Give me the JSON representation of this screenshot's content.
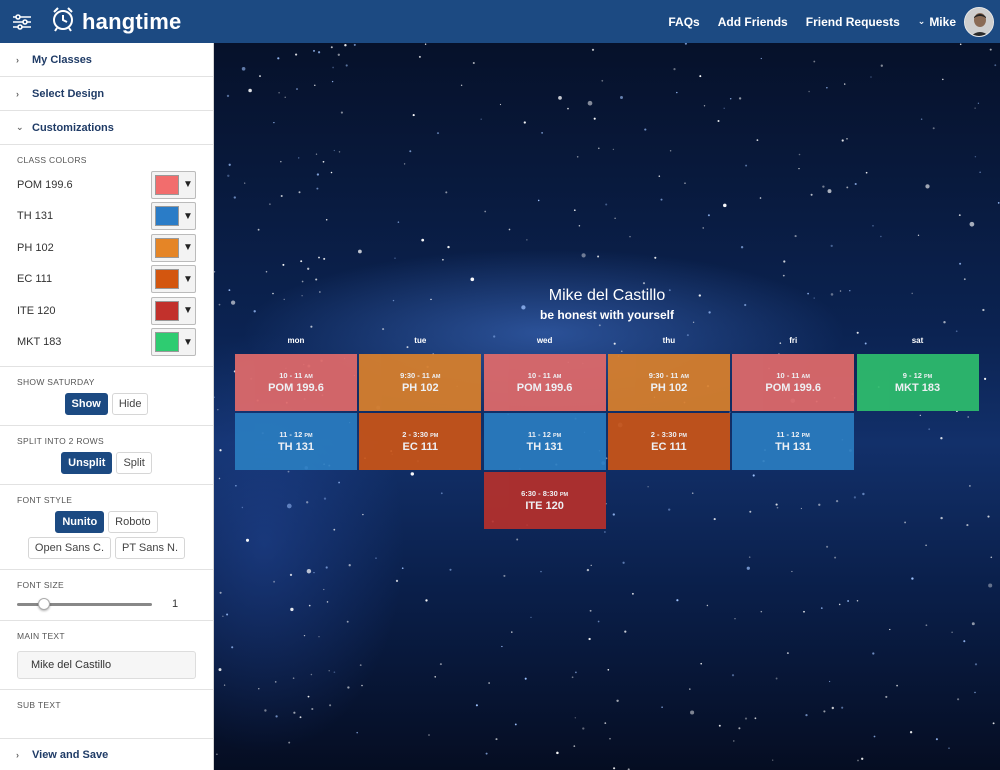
{
  "header": {
    "app_name": "hangtime",
    "nav": [
      "FAQs",
      "Add Friends",
      "Friend Requests"
    ],
    "user_name": "Mike"
  },
  "sidebar": {
    "sections": {
      "my_classes": "My Classes",
      "select_design": "Select Design",
      "customizations": "Customizations",
      "view_save": "View and Save"
    },
    "class_colors": {
      "title": "CLASS COLORS",
      "items": [
        {
          "name": "POM 199.6",
          "color": "#f26d6d"
        },
        {
          "name": "TH 131",
          "color": "#2a7cc7"
        },
        {
          "name": "PH 102",
          "color": "#e58526"
        },
        {
          "name": "EC 111",
          "color": "#d3560f"
        },
        {
          "name": "ITE 120",
          "color": "#c2312c"
        },
        {
          "name": "MKT 183",
          "color": "#2ecc71"
        }
      ]
    },
    "show_saturday": {
      "title": "SHOW SATURDAY",
      "options": [
        "Show",
        "Hide"
      ],
      "selected": "Show"
    },
    "split_rows": {
      "title": "SPLIT INTO 2 ROWS",
      "options": [
        "Unsplit",
        "Split"
      ],
      "selected": "Unsplit"
    },
    "font_style": {
      "title": "FONT STYLE",
      "options": [
        "Nunito",
        "Roboto",
        "Open Sans C.",
        "PT Sans N."
      ],
      "selected": "Nunito"
    },
    "font_size": {
      "title": "FONT SIZE",
      "value": "1",
      "fraction": 0.2
    },
    "main_text": {
      "title": "MAIN TEXT",
      "value": "Mike del Castillo"
    },
    "sub_text": {
      "title": "SUB TEXT"
    }
  },
  "schedule": {
    "title": "Mike del Castillo",
    "subtitle": "be honest with yourself",
    "days": [
      "mon",
      "tue",
      "wed",
      "thu",
      "fri",
      "sat"
    ],
    "classes": [
      {
        "day": 0,
        "row": 0,
        "time": "10 - 11",
        "ampm": "AM",
        "name": "POM 199.6",
        "color": "#e06a6a"
      },
      {
        "day": 0,
        "row": 1,
        "time": "11 - 12",
        "ampm": "PM",
        "name": "TH 131",
        "color": "#2a7cc0"
      },
      {
        "day": 1,
        "row": 0,
        "time": "9:30 - 11",
        "ampm": "AM",
        "name": "PH 102",
        "color": "#d9802c"
      },
      {
        "day": 1,
        "row": 1,
        "time": "2 - 3:30",
        "ampm": "PM",
        "name": "EC 111",
        "color": "#c95417"
      },
      {
        "day": 2,
        "row": 0,
        "time": "10 - 11",
        "ampm": "AM",
        "name": "POM 199.6",
        "color": "#e06a6a"
      },
      {
        "day": 2,
        "row": 1,
        "time": "11 - 12",
        "ampm": "PM",
        "name": "TH 131",
        "color": "#2a7cc0"
      },
      {
        "day": 2,
        "row": 2,
        "time": "6:30 - 8:30",
        "ampm": "PM",
        "name": "ITE 120",
        "color": "#b5302c"
      },
      {
        "day": 3,
        "row": 0,
        "time": "9:30 - 11",
        "ampm": "AM",
        "name": "PH 102",
        "color": "#d9802c"
      },
      {
        "day": 3,
        "row": 1,
        "time": "2 - 3:30",
        "ampm": "PM",
        "name": "EC 111",
        "color": "#c95417"
      },
      {
        "day": 4,
        "row": 0,
        "time": "10 - 11",
        "ampm": "AM",
        "name": "POM 199.6",
        "color": "#e06a6a"
      },
      {
        "day": 4,
        "row": 1,
        "time": "11 - 12",
        "ampm": "PM",
        "name": "TH 131",
        "color": "#2a7cc0"
      },
      {
        "day": 5,
        "row": 0,
        "time": "9 - 12",
        "ampm": "PM",
        "name": "MKT 183",
        "color": "#2ebd6d"
      }
    ]
  }
}
